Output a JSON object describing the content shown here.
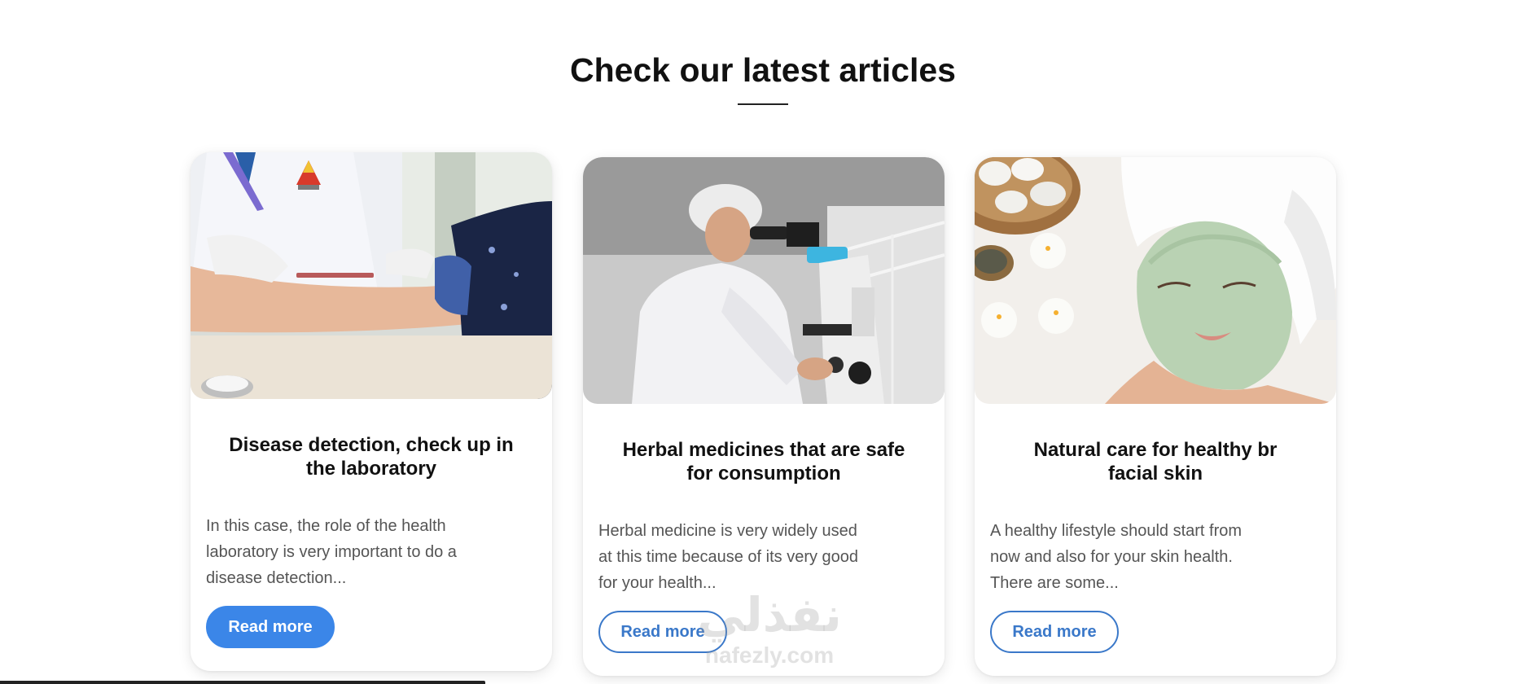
{
  "section": {
    "title": "Check our latest articles"
  },
  "articles": [
    {
      "title": "Disease detection, check up in the laboratory",
      "excerpt": "In this case, the role of the health laboratory is very important to do a disease detection...",
      "button_label": "Read more",
      "image": "lab-blood-test-photo"
    },
    {
      "title": "Herbal medicines that are safe for consumption",
      "excerpt": "Herbal medicine is very widely used at this time because of its very good for your health...",
      "button_label": "Read more",
      "image": "scientist-microscope-photo"
    },
    {
      "title": "Natural care for healthy br facial skin",
      "excerpt": "A healthy lifestyle should start from now and also for your skin health. There are some...",
      "button_label": "Read more",
      "image": "facial-mask-spa-photo"
    }
  ],
  "watermark": {
    "logo": "نفذلي",
    "site": "nafezly.com"
  },
  "colors": {
    "accent": "#3b86e8",
    "accent_outline": "#3a78c9",
    "title": "#111111",
    "text": "#555555"
  }
}
